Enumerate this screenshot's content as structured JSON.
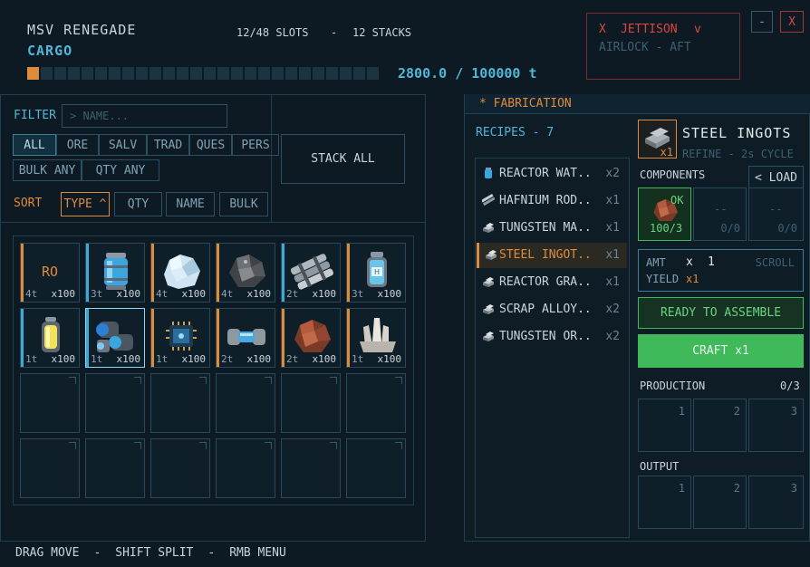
{
  "header": {
    "ship_name": "MSV RENEGADE",
    "section": "CARGO",
    "slots": "12/48 SLOTS",
    "separator": "-",
    "stacks": "12 STACKS",
    "capacity_fill": 0.028,
    "weight": "2800.0 / 100000 t"
  },
  "jettison": {
    "x_mark": "X",
    "label": "JETTISON",
    "chevron": "v",
    "sublabel": "AIRLOCK - AFT"
  },
  "window_buttons": {
    "minimize": "-",
    "close": "X"
  },
  "filter": {
    "label": "FILTER",
    "placeholder": "> NAME...",
    "chips": [
      "ALL",
      "ORE",
      "SALV",
      "TRAD",
      "QUES",
      "PERS"
    ],
    "chips2": [
      "BULK ANY",
      "QTY ANY"
    ],
    "stack_all": "STACK ALL"
  },
  "sort": {
    "label": "SORT",
    "options": [
      "TYPE ^",
      "QTY",
      "NAME",
      "BULK"
    ]
  },
  "slots": [
    {
      "bar": "#e08a3c",
      "abbr": "RO",
      "wt": "4t",
      "qty": "x100",
      "icon": "raw-ore-placeholder-icon"
    },
    {
      "bar": "#3fa9d6",
      "abbr": "",
      "wt": "3t",
      "qty": "x100",
      "icon": "blue-coolant-canister-icon"
    },
    {
      "bar": "#e08a3c",
      "abbr": "",
      "wt": "4t",
      "qty": "x100",
      "icon": "ice-chunk-icon"
    },
    {
      "bar": "#e08a3c",
      "abbr": "",
      "wt": "4t",
      "qty": "x100",
      "icon": "dark-ore-chunk-icon"
    },
    {
      "bar": "#3fa9d6",
      "abbr": "",
      "wt": "2t",
      "qty": "x100",
      "icon": "metal-rods-bundle-icon"
    },
    {
      "bar": "#e08a3c",
      "abbr": "",
      "wt": "3t",
      "qty": "x100",
      "icon": "hydrogen-canister-icon"
    },
    {
      "bar": "#3fa9d6",
      "abbr": "",
      "wt": "1t",
      "qty": "x100",
      "icon": "yellow-fuel-cell-icon"
    },
    {
      "bar": "#3fa9d6",
      "abbr": "",
      "wt": "1t",
      "qty": "x100",
      "icon": "blue-lens-cluster-icon"
    },
    {
      "bar": "#e08a3c",
      "abbr": "",
      "wt": "1t",
      "qty": "x100",
      "icon": "circuit-chip-icon"
    },
    {
      "bar": "#e08a3c",
      "abbr": "",
      "wt": "2t",
      "qty": "x100",
      "icon": "coupling-part-icon"
    },
    {
      "bar": "#e08a3c",
      "abbr": "",
      "wt": "2t",
      "qty": "x100",
      "icon": "copper-ore-chunk-icon"
    },
    {
      "bar": "#e08a3c",
      "abbr": "",
      "wt": "1t",
      "qty": "x100",
      "icon": "white-crystal-cluster-icon"
    }
  ],
  "fabrication": {
    "title": "* FABRICATION",
    "recipes_label": "RECIPES - 7",
    "recipes": [
      {
        "label": "REACTOR WAT..",
        "count": "x2",
        "icon": "water-canister-icon"
      },
      {
        "label": "HAFNIUM ROD..",
        "count": "x1",
        "icon": "rod-bundle-icon"
      },
      {
        "label": "TUNGSTEN MA..",
        "count": "x1",
        "icon": "ingot-stack-icon"
      },
      {
        "label": "STEEL INGOT..",
        "count": "x1",
        "icon": "steel-ingot-icon"
      },
      {
        "label": "REACTOR GRA..",
        "count": "x1",
        "icon": "ingot-stack-icon"
      },
      {
        "label": "SCRAP ALLOY..",
        "count": "x2",
        "icon": "ingot-stack-icon"
      },
      {
        "label": "TUNGSTEN OR..",
        "count": "x2",
        "icon": "ingot-stack-icon"
      }
    ],
    "selected_index": 3,
    "product_name": "STEEL INGOTS",
    "product_sub": "REFINE - 2s CYCLE",
    "product_count": "x1",
    "components_label": "COMPONENTS",
    "load_button": "< LOAD",
    "components": [
      {
        "status": "OK",
        "amount": "100/3",
        "filled": true
      },
      {
        "status": "--",
        "amount": "0/0",
        "filled": false
      },
      {
        "status": "--",
        "amount": "0/0",
        "filled": false
      }
    ],
    "amt_label": "AMT",
    "amt_x": "x",
    "amt_value": "1",
    "scroll_label": "SCROLL",
    "yield_label": "YIELD",
    "yield_value": "x1",
    "ready_label": "READY TO ASSEMBLE",
    "craft_label": "CRAFT x1",
    "production_label": "PRODUCTION",
    "production_count": "0/3",
    "production_slots": [
      "1",
      "2",
      "3"
    ],
    "output_label": "OUTPUT",
    "output_slots": [
      "1",
      "2",
      "3"
    ]
  },
  "footer": {
    "drag": "DRAG MOVE",
    "sep1": "-",
    "shift": "SHIFT SPLIT",
    "sep2": "-",
    "rmb": "RMB MENU"
  },
  "colors": {
    "accent_orange": "#e08a3c",
    "accent_cyan": "#52b6d4",
    "craft_green": "#3fb95a",
    "jettison_red": "#d8483c"
  }
}
